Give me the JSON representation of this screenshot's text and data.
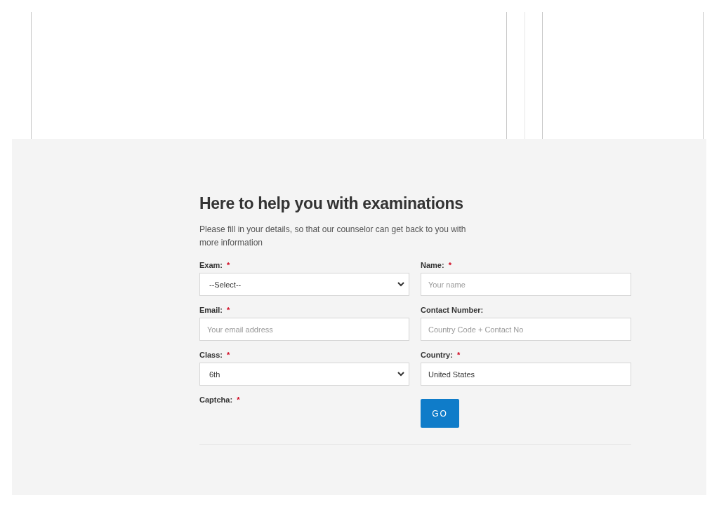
{
  "heading": "Here to help you with examinations",
  "intro": "Please fill in your details, so that our counselor can get back to you with more information",
  "fields": [
    {
      "label": "Exam:",
      "required": true,
      "kind": "select",
      "value": "--Select--"
    },
    {
      "label": "Name:",
      "required": true,
      "kind": "input",
      "placeholder": "Your name"
    },
    {
      "label": "Email:",
      "required": true,
      "kind": "input",
      "placeholder": "Your email address"
    },
    {
      "label": "Contact Number:",
      "required": false,
      "kind": "input",
      "placeholder": "Country Code + Contact No"
    },
    {
      "label": "Class:",
      "required": true,
      "kind": "select",
      "value": "6th"
    },
    {
      "label": "Country:",
      "required": true,
      "kind": "input",
      "value": "United States"
    },
    {
      "label": "Captcha:",
      "required": true,
      "kind": "empty"
    },
    {
      "kind": "button",
      "label": "GO"
    }
  ],
  "required_mark": "*"
}
